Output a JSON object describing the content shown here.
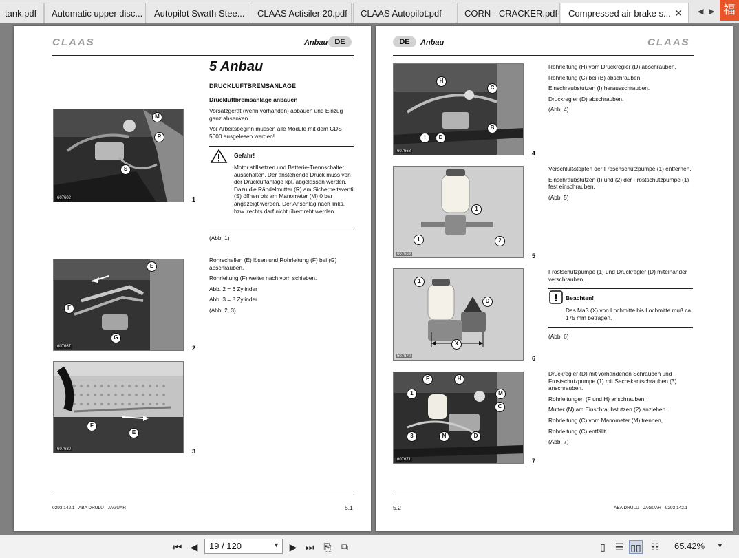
{
  "tabs": [
    {
      "label": "tank.pdf",
      "active": false
    },
    {
      "label": "Automatic upper disc...",
      "active": false
    },
    {
      "label": "Autopilot Swath Stee...",
      "active": false
    },
    {
      "label": "CLAAS Actisiler 20.pdf",
      "active": false
    },
    {
      "label": "CLAAS Autopilot.pdf",
      "active": false
    },
    {
      "label": "CORN - CRACKER.pdf",
      "active": false
    },
    {
      "label": "Compressed air brake s...",
      "active": true
    }
  ],
  "tab_close_glyph": "✕",
  "app_glyph": "福",
  "left_page": {
    "logo": "CLAAS",
    "header_title": "Anbau",
    "lang": "DE",
    "chapter": "5 Anbau",
    "section": "DRUCKLUFTBREMSANLAGE",
    "subsection": "Druckluftbremsanlage anbauen",
    "para1": "Vorsatzgerät (wenn vorhanden) abbauen und Einzug ganz absenken.",
    "para2": "Vor Arbeitsbeginn müssen alle Module mit dem CDS 5000 ausgelesen werden!",
    "warning_title": "Gefahr!",
    "warning_text": "Motor stillsetzen und Batterie-Trennschalter ausschalten. Der anstehende Druck muss von der Druckluftanlage kpl. abgelassen werden. Dazu die Rändelmutter (R) am Sicherheitsventil (S) öffnen bis am Manometer (M) 0 bar angezeigt werden. Der Anschlag nach links, bzw. rechts darf nicht überdreht werden.",
    "ref1": "(Abb. 1)",
    "step2": "Rohrschellen (E) lösen und Rohrleitung (F) bei (G) abschrauben.",
    "step3": "Rohrleitung (F) weiter nach vorn schieben.",
    "step4": "Abb. 2 = 6 Zylinder",
    "step5": "Abb. 3 = 8 Zylinder",
    "ref2": "(Abb. 2, 3)",
    "figures": [
      {
        "code": "607602",
        "num": "1",
        "callouts": [
          "M",
          "R",
          "S"
        ]
      },
      {
        "code": "607667",
        "num": "2",
        "callouts": [
          "E",
          "F",
          "G"
        ]
      },
      {
        "code": "607680",
        "num": "3",
        "callouts": [
          "F",
          "E"
        ]
      }
    ],
    "footer": "0293 142.1 - ABA DRULU - JAGUAR",
    "page_number": "5.1"
  },
  "right_page": {
    "logo": "CLAAS",
    "header_title": "Anbau",
    "lang": "DE",
    "block1": [
      "Rohrleitung (H) vom Druckregler (D) abschrauben.",
      "Rohrleitung (C) bei (B) abschrauben.",
      "Einschraubstutzen (I) herausschrauben.",
      "Druckregler (D) abschrauben.",
      "(Abb. 4)"
    ],
    "block2": [
      "Verschlußstopfen der Froschschutzpumpe (1) entfernen.",
      "Einschraubstutzen (I) und (2) der Frostschutzpumpe (1) fest einschrauben.",
      "(Abb. 5)"
    ],
    "block3": "Frostschutzpumpe (1) und Druckregler (D) miteinander verschrauben.",
    "note_title": "Beachten!",
    "note_text": "Das Maß (X) von Lochmitte bis Lochmitte muß ca. 175 mm betragen.",
    "ref6": "(Abb. 6)",
    "block4": [
      "Druckregler (D) mit vorhandenen Schrauben und Frostschutzpumpe (1) mit Sechskantschrauben (3) anschrauben.",
      "Rohrleitungen (F und H) anschrauben.",
      "Mutter (N) am Einschraubstutzen (2) anziehen.",
      "Rohrleitung (C) vom Manometer (M) trennen,",
      "Rohrleitung (C) entfällt.",
      "(Abb. 7)"
    ],
    "figures": [
      {
        "code": "607668",
        "num": "4",
        "callouts": [
          "H",
          "C",
          "B",
          "I",
          "D"
        ]
      },
      {
        "code": "607669",
        "num": "5",
        "callouts": [
          "1",
          "I",
          "2"
        ]
      },
      {
        "code": "607670",
        "num": "6",
        "callouts": [
          "1",
          "D",
          "X"
        ]
      },
      {
        "code": "607671",
        "num": "7",
        "callouts": [
          "F",
          "H",
          "1",
          "M",
          "C",
          "3",
          "N",
          "D"
        ]
      }
    ],
    "footer": "ABA DRULU - JAGUAR - 0293 142.1",
    "page_number": "5.2"
  },
  "toolbar": {
    "page_indicator": "19 / 120",
    "zoom": "65.42%"
  }
}
